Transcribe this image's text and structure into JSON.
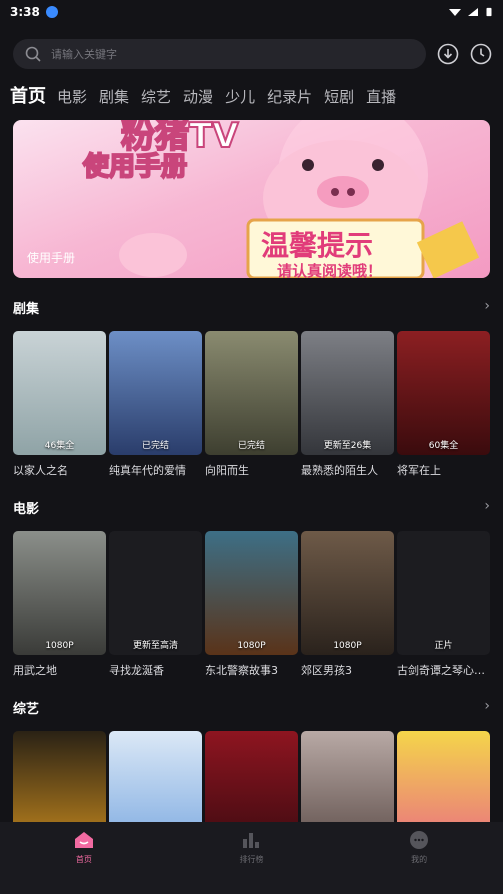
{
  "status": {
    "time": "3:38"
  },
  "search": {
    "placeholder": "请输入关键字"
  },
  "tabs": [
    "首页",
    "电影",
    "剧集",
    "综艺",
    "动漫",
    "少儿",
    "纪录片",
    "短剧",
    "直播"
  ],
  "banner": {
    "caption": "使用手册",
    "art_title": "粉猪TV",
    "art_subtitle": "使用手册",
    "art_sign": "温馨提示",
    "art_sub": "请认真阅读哦！"
  },
  "sections": [
    {
      "title": "剧集",
      "items": [
        {
          "title": "以家人之名",
          "badge": "46集全",
          "colors": [
            "#c9d3d6",
            "#8fa3a6"
          ]
        },
        {
          "title": "纯真年代的爱情",
          "badge": "已完结",
          "colors": [
            "#6d8fc6",
            "#2a3d6b"
          ]
        },
        {
          "title": "向阳而生",
          "badge": "已完结",
          "colors": [
            "#8a8b70",
            "#3e3f30"
          ]
        },
        {
          "title": "最熟悉的陌生人",
          "badge": "更新至26集",
          "colors": [
            "#7d7f85",
            "#34363b"
          ]
        },
        {
          "title": "将军在上",
          "badge": "60集全",
          "colors": [
            "#8c1f22",
            "#3a0b0d"
          ]
        }
      ]
    },
    {
      "title": "电影",
      "items": [
        {
          "title": "用武之地",
          "badge": "1080P",
          "colors": [
            "#8b8f8a",
            "#3a3b38"
          ]
        },
        {
          "title": "寻找龙涎香",
          "badge": "更新至高清",
          "colors": [
            "#1c1c20",
            "#1c1c20"
          ]
        },
        {
          "title": "东北警察故事3",
          "badge": "1080P",
          "colors": [
            "#3d6f86",
            "#5a3319"
          ]
        },
        {
          "title": "郊区男孩3",
          "badge": "1080P",
          "colors": [
            "#6e5a48",
            "#2a221c"
          ]
        },
        {
          "title": "古剑奇谭之琴心剑魄",
          "badge": "正片",
          "colors": [
            "#1c1c20",
            "#1c1c20"
          ]
        }
      ]
    },
    {
      "title": "综艺",
      "items": [
        {
          "title": "",
          "badge": "",
          "colors": [
            "#2a2215",
            "#c98b1e"
          ]
        },
        {
          "title": "",
          "badge": "",
          "colors": [
            "#dbe8f6",
            "#7aa8e0"
          ]
        },
        {
          "title": "",
          "badge": "",
          "colors": [
            "#8e1520",
            "#3a0a10"
          ]
        },
        {
          "title": "",
          "badge": "",
          "colors": [
            "#b8a9a5",
            "#5b4b47"
          ]
        },
        {
          "title": "",
          "badge": "",
          "colors": [
            "#f4d54a",
            "#e86a86"
          ]
        }
      ]
    }
  ],
  "nav": [
    {
      "label": "首页",
      "icon": "home-icon",
      "active": true
    },
    {
      "label": "排行榜",
      "icon": "ranking-icon",
      "active": false
    },
    {
      "label": "我的",
      "icon": "profile-icon",
      "active": false
    }
  ]
}
